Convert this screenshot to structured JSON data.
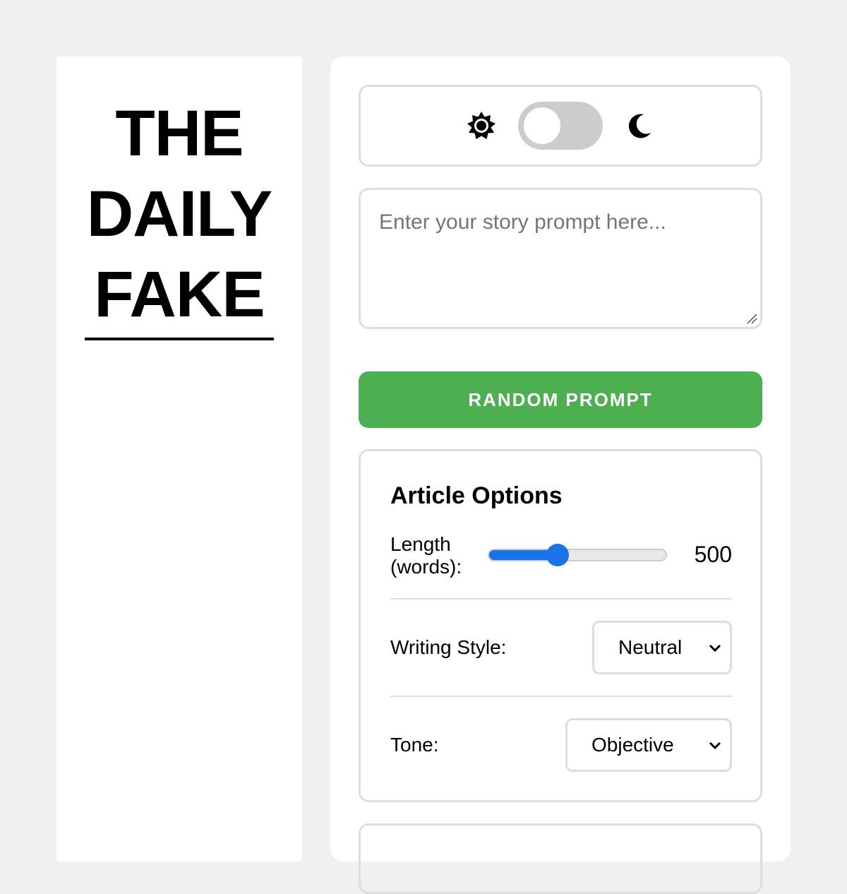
{
  "masthead": {
    "line1": "THE",
    "line2": "DAILY",
    "line3": "FAKE"
  },
  "theme_toggle": {
    "light_icon": "sun-icon",
    "dark_icon": "moon-icon",
    "state": "light"
  },
  "prompt": {
    "placeholder": "Enter your story prompt here...",
    "value": ""
  },
  "random_button": {
    "label": "RANDOM PROMPT",
    "color": "#4caf50"
  },
  "options": {
    "title": "Article Options",
    "length": {
      "label_line1": "Length",
      "label_line2": "(words):",
      "value": "500",
      "slider_fraction": 0.39,
      "accent": "#1a73e8"
    },
    "writing_style": {
      "label": "Writing Style:",
      "selected": "Neutral"
    },
    "tone": {
      "label": "Tone:",
      "selected": "Objective"
    }
  }
}
